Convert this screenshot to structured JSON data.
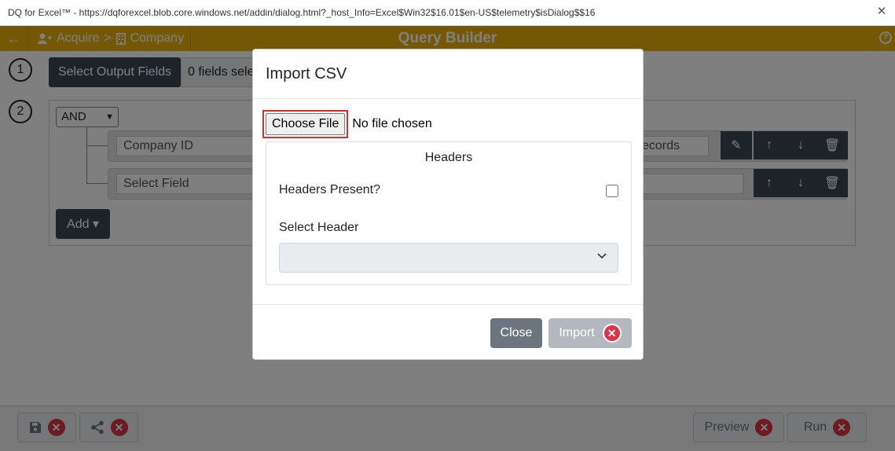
{
  "window": {
    "title": "DQ for Excel™ - https://dqforexcel.blob.core.windows.net/addin/dialog.html?_host_Info=Excel$Win32$16.01$en-US$telemetry$isDialog$$16",
    "close_glyph": "✕"
  },
  "header": {
    "back_glyph": "←",
    "breadcrumb": [
      "Acquire",
      "Company"
    ],
    "breadcrumb_sep": ">",
    "title": "Query Builder",
    "help_glyph": "?"
  },
  "steps": {
    "step1_number": "1",
    "step2_number": "2",
    "select_output_label": "Select Output Fields",
    "fields_selected_text": "0 fields sele",
    "logic_operator": "AND",
    "row1_field": "Company ID",
    "row1_value": "ecords",
    "row2_field": "Select Field",
    "add_label": "Add ▾"
  },
  "footer": {
    "preview_label": "Preview",
    "run_label": "Run"
  },
  "modal": {
    "title": "Import CSV",
    "choose_file_label": "Choose File",
    "file_status": "No file chosen",
    "headers_title": "Headers",
    "headers_present_label": "Headers Present?",
    "headers_present_checked": false,
    "select_header_label": "Select Header",
    "select_header_value": "",
    "close_label": "Close",
    "import_label": "Import"
  },
  "colors": {
    "header_bg": "#e8b10a",
    "dark_button": "#3c4752",
    "danger": "#dc3545",
    "highlight_border": "#d32f2f"
  }
}
